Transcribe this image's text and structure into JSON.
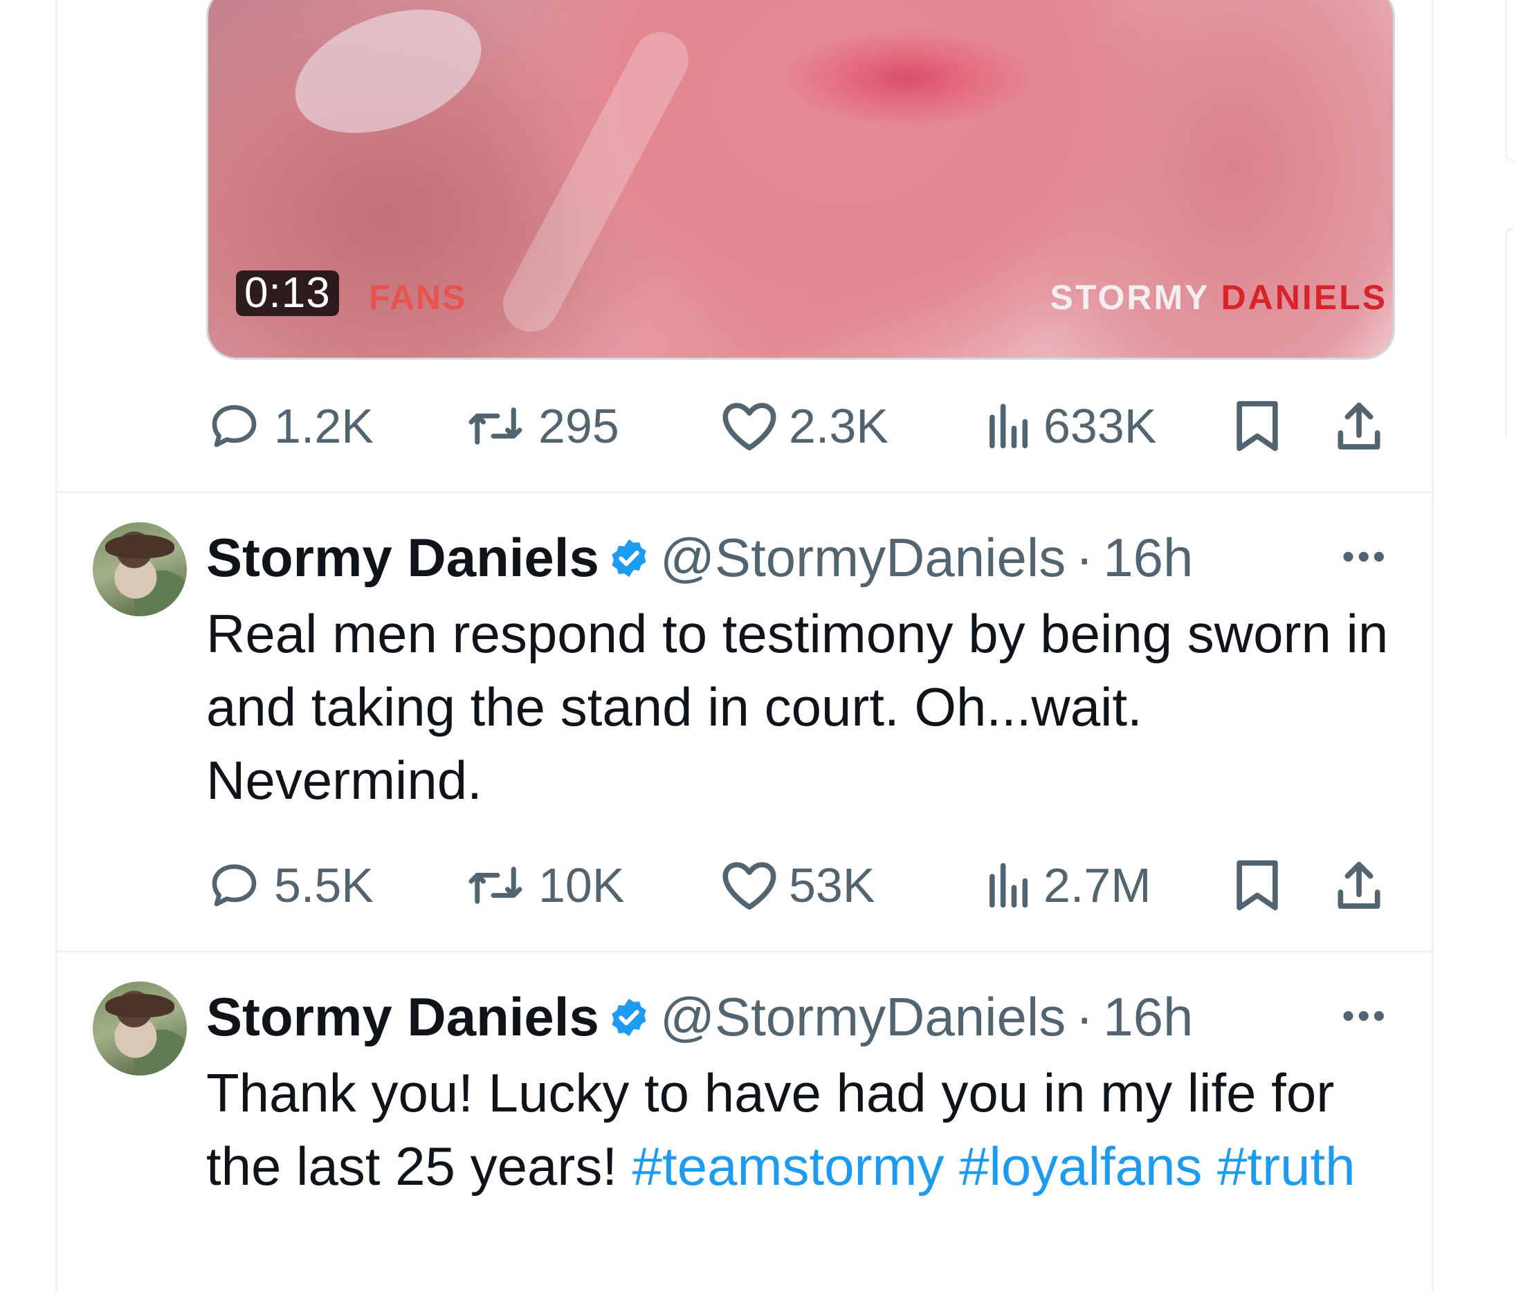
{
  "media": {
    "duration": "0:13",
    "watermark_left": "FANS",
    "watermark_right_1": "STORMY",
    "watermark_right_2": "DANIELS"
  },
  "post0_stats": {
    "replies": "1.2K",
    "reposts": "295",
    "likes": "2.3K",
    "views": "633K"
  },
  "tweets": [
    {
      "name": "Stormy Daniels",
      "handle": "@StormyDaniels",
      "dot": "·",
      "time": "16h",
      "more": "•••",
      "text": "Real men respond to testimony by being sworn in and taking the stand in court. Oh...wait. Nevermind.",
      "stats": {
        "replies": "5.5K",
        "reposts": "10K",
        "likes": "53K",
        "views": "2.7M"
      }
    },
    {
      "name": "Stormy Daniels",
      "handle": "@StormyDaniels",
      "dot": "·",
      "time": "16h",
      "more": "•••",
      "text_plain": "Thank you! Lucky to have had you in my life for the last 25 years!",
      "hashtags": [
        "#teamstormy",
        "#loyalfans",
        "#truth"
      ]
    }
  ],
  "icons": {
    "reply": "reply-icon",
    "repost": "repost-icon",
    "like": "heart-icon",
    "views": "views-icon",
    "bookmark": "bookmark-icon",
    "share": "share-icon",
    "verified": "verified-badge-icon"
  },
  "colors": {
    "text": "#0f1419",
    "secondary": "#536471",
    "link": "#1d9bf0",
    "verified": "#1d9bf0",
    "divider": "#eff3f4"
  }
}
